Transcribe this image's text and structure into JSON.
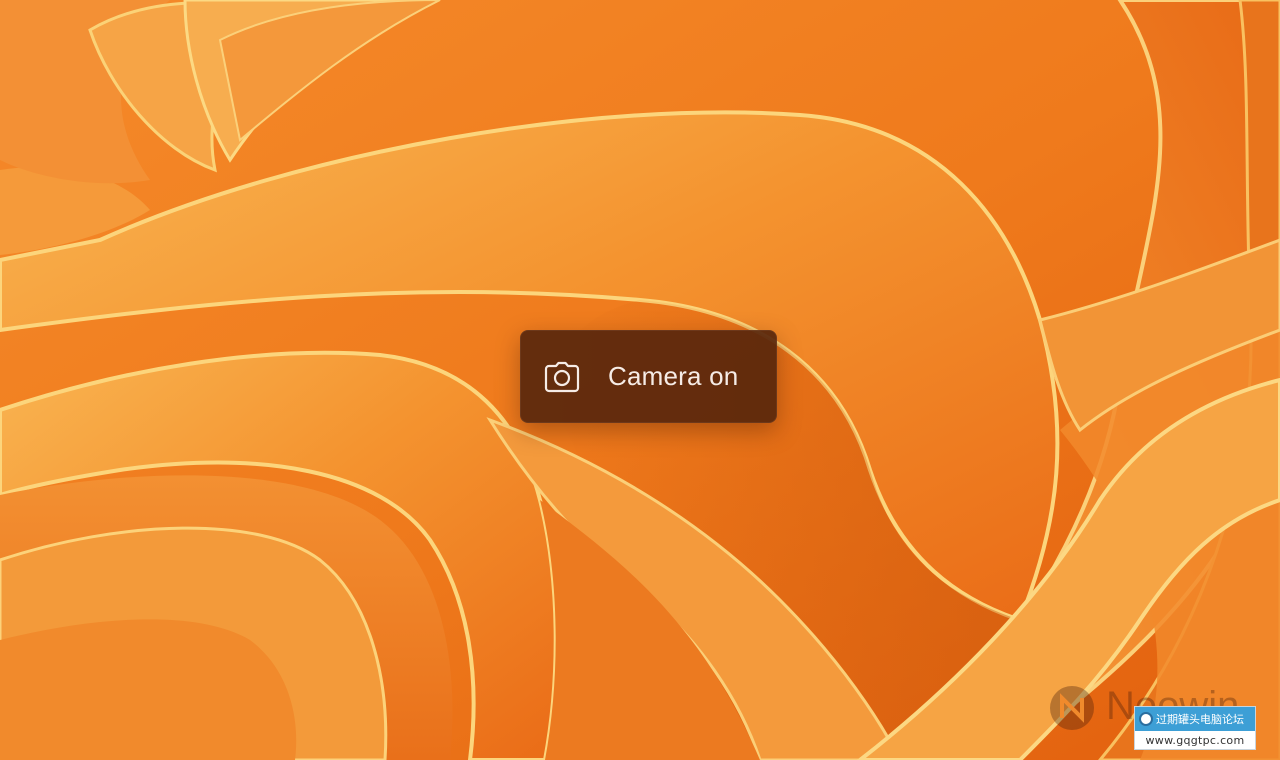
{
  "notification": {
    "icon": "camera-icon",
    "label": "Camera on"
  },
  "watermark": {
    "brand_text": "Neowin",
    "site_badge_name": "过期罐头电脑论坛",
    "site_badge_url": "www.gqgtpc.com"
  },
  "colors": {
    "wallpaper_base": "#f0781e",
    "wallpaper_highlight": "#f7c873",
    "toast_background": "#58260c",
    "toast_text": "#f6ece6",
    "badge_blue": "#3d9fd6"
  }
}
